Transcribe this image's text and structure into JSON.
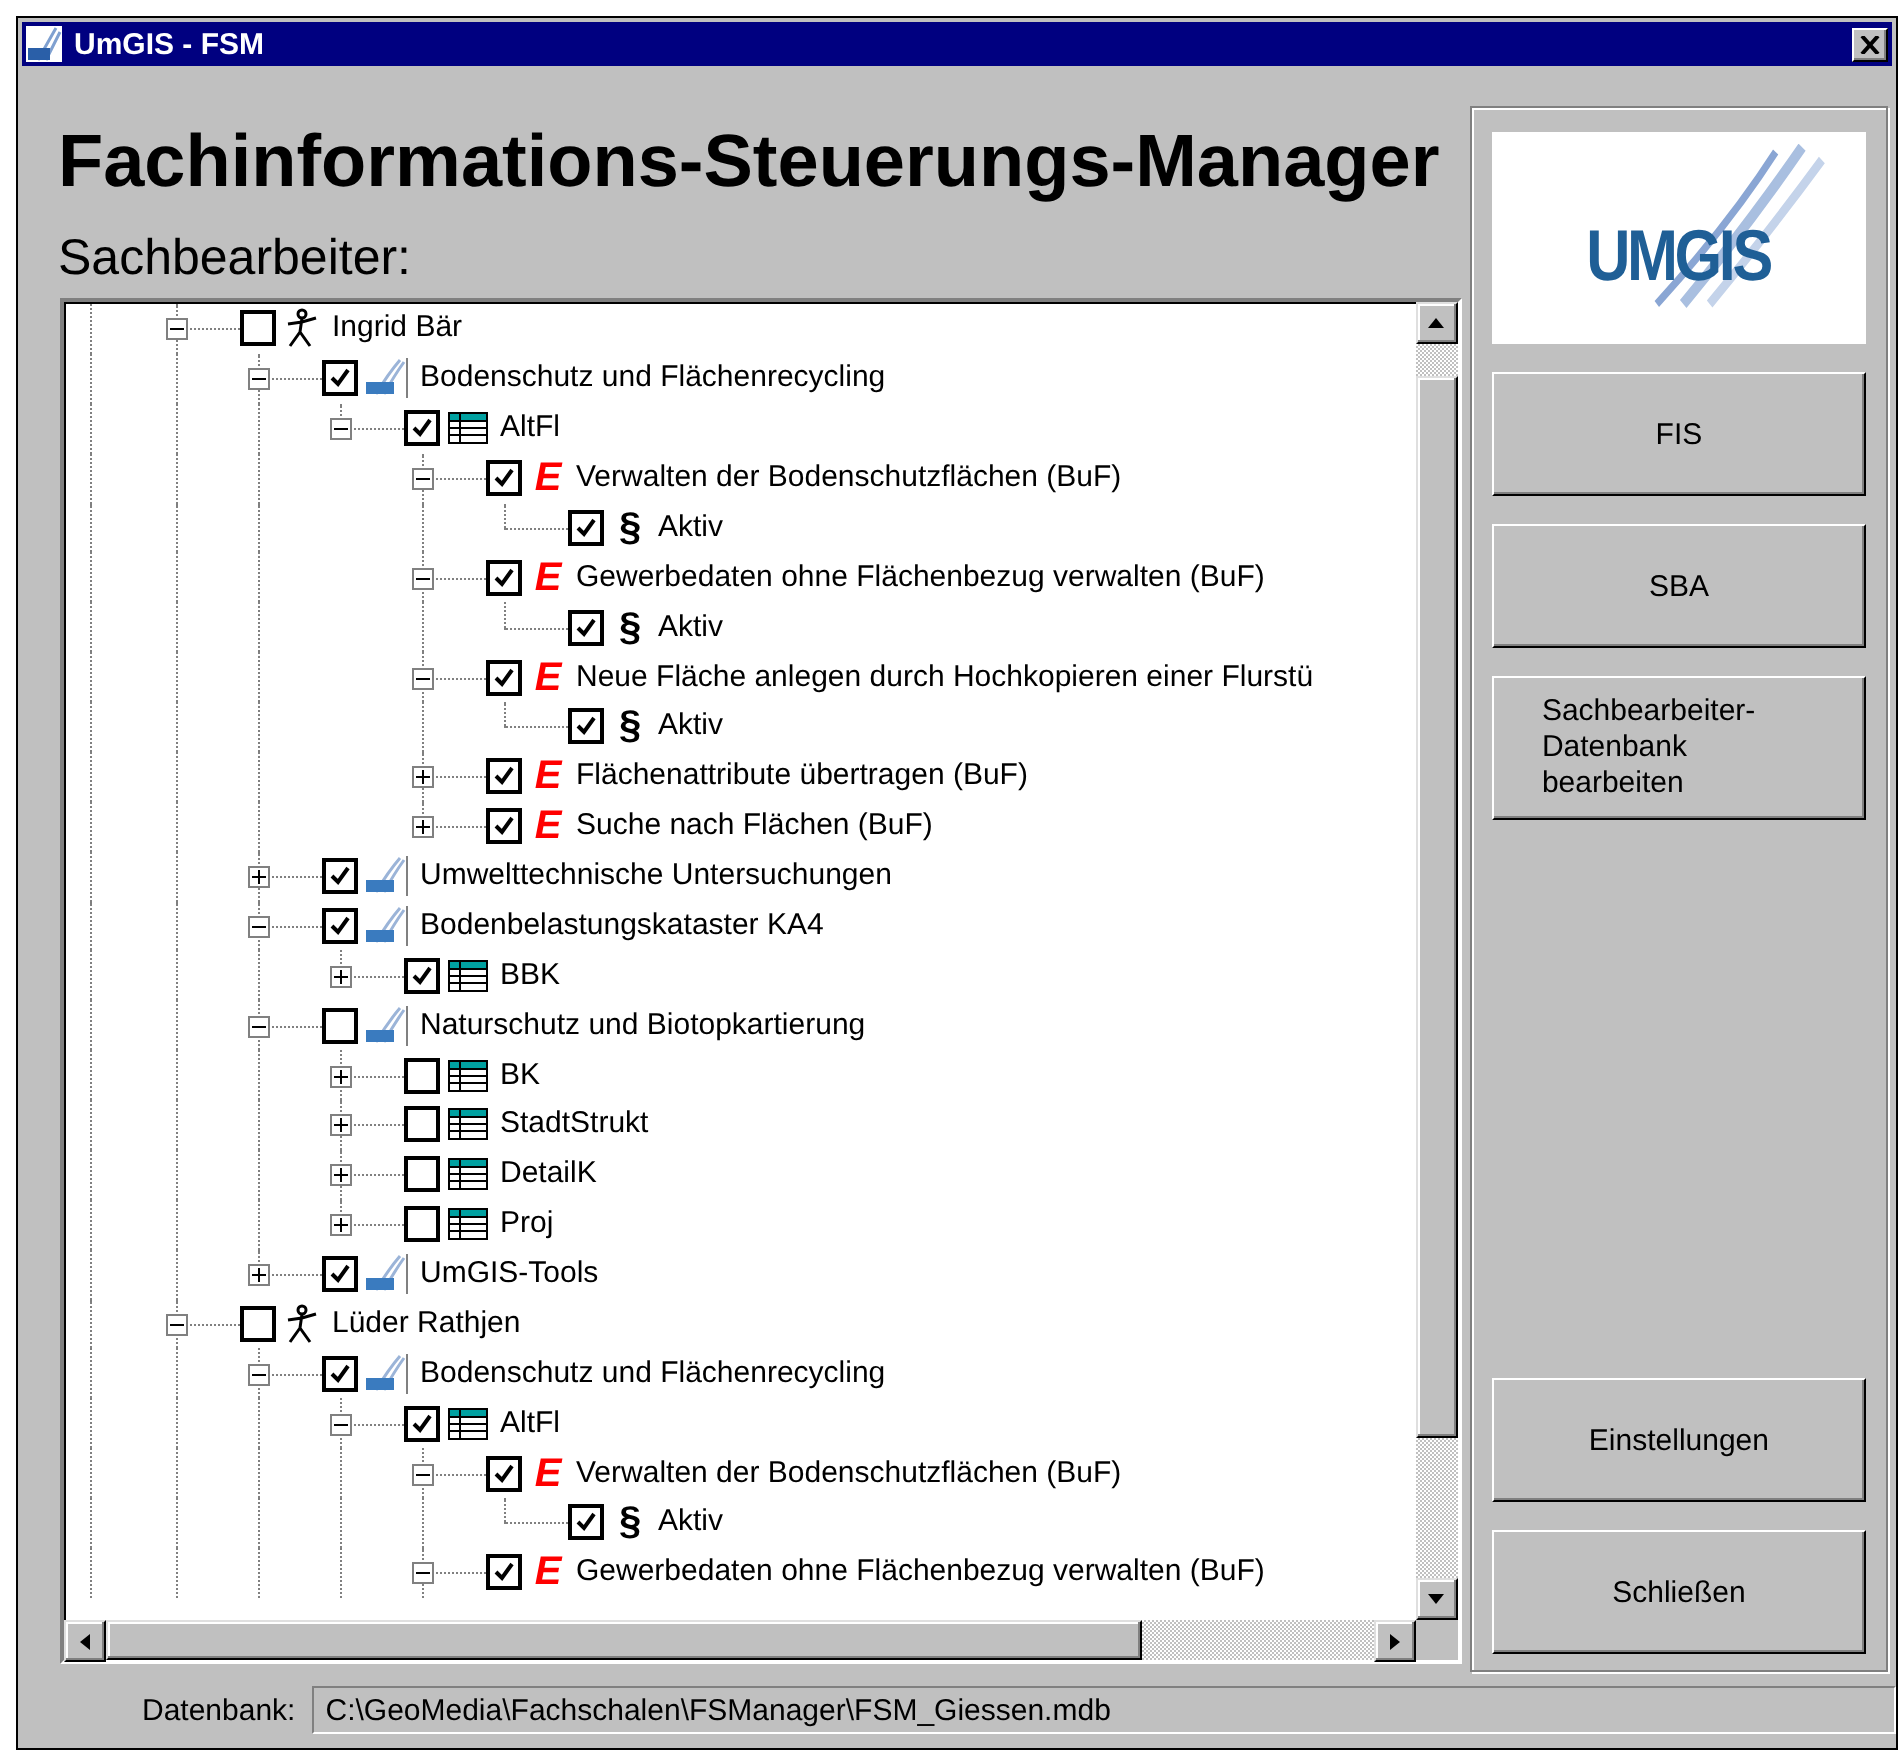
{
  "window": {
    "title": "UmGIS - FSM"
  },
  "heading": "Fachinformations-Steuerungs-Manager",
  "tree_label": "Sachbearbeiter:",
  "tree": [
    {
      "kind": "person",
      "label": "Ingrid Bär",
      "checked": false,
      "expanded": true,
      "children": [
        {
          "kind": "module",
          "label": "Bodenschutz und Flächenrecycling",
          "checked": true,
          "expanded": true,
          "children": [
            {
              "kind": "table",
              "label": "AltFl",
              "checked": true,
              "expanded": true,
              "children": [
                {
                  "kind": "function",
                  "glyph": "E",
                  "label": "Verwalten der Bodenschutzflächen (BuF)",
                  "checked": true,
                  "expanded": true,
                  "children": [
                    {
                      "kind": "status",
                      "glyph": "§",
                      "label": "Aktiv",
                      "checked": true
                    }
                  ]
                },
                {
                  "kind": "function",
                  "glyph": "E",
                  "label": "Gewerbedaten ohne Flächenbezug verwalten (BuF)",
                  "checked": true,
                  "expanded": true,
                  "children": [
                    {
                      "kind": "status",
                      "glyph": "§",
                      "label": "Aktiv",
                      "checked": true
                    }
                  ]
                },
                {
                  "kind": "function",
                  "glyph": "E",
                  "label": "Neue Fläche anlegen durch Hochkopieren einer Flurstü",
                  "checked": true,
                  "expanded": true,
                  "children": [
                    {
                      "kind": "status",
                      "glyph": "§",
                      "label": "Aktiv",
                      "checked": true
                    }
                  ]
                },
                {
                  "kind": "function",
                  "glyph": "E",
                  "label": "Flächenattribute übertragen (BuF)",
                  "checked": true,
                  "expanded": false
                },
                {
                  "kind": "function",
                  "glyph": "E",
                  "label": "Suche nach Flächen (BuF)",
                  "checked": true,
                  "expanded": false
                }
              ]
            }
          ]
        },
        {
          "kind": "module",
          "label": "Umwelttechnische Untersuchungen",
          "checked": true,
          "expanded": false
        },
        {
          "kind": "module",
          "label": "Bodenbelastungskataster KA4",
          "checked": true,
          "expanded": true,
          "children": [
            {
              "kind": "table",
              "label": "BBK",
              "checked": true,
              "expanded": false
            }
          ]
        },
        {
          "kind": "module",
          "label": "Naturschutz und Biotopkartierung",
          "checked": false,
          "expanded": true,
          "children": [
            {
              "kind": "table",
              "label": "BK",
              "checked": false,
              "expanded": false
            },
            {
              "kind": "table",
              "label": "StadtStrukt",
              "checked": false,
              "expanded": false
            },
            {
              "kind": "table",
              "label": "DetailK",
              "checked": false,
              "expanded": false
            },
            {
              "kind": "table",
              "label": "Proj",
              "checked": false,
              "expanded": false
            }
          ]
        },
        {
          "kind": "module",
          "label": "UmGIS-Tools",
          "checked": true,
          "expanded": false
        }
      ]
    },
    {
      "kind": "person",
      "label": "Lüder Rathjen",
      "checked": false,
      "expanded": true,
      "children": [
        {
          "kind": "module",
          "label": "Bodenschutz und Flächenrecycling",
          "checked": true,
          "expanded": true,
          "children": [
            {
              "kind": "table",
              "label": "AltFl",
              "checked": true,
              "expanded": true,
              "children": [
                {
                  "kind": "function",
                  "glyph": "E",
                  "label": "Verwalten der Bodenschutzflächen (BuF)",
                  "checked": true,
                  "expanded": true,
                  "children": [
                    {
                      "kind": "status",
                      "glyph": "§",
                      "label": "Aktiv",
                      "checked": true
                    }
                  ]
                },
                {
                  "kind": "function",
                  "glyph": "E",
                  "label": "Gewerbedaten ohne Flächenbezug verwalten (BuF)",
                  "checked": true,
                  "expanded": true
                }
              ]
            }
          ]
        }
      ]
    }
  ],
  "logo": {
    "text": "UMGIS"
  },
  "buttons_top": [
    {
      "kind": "plain",
      "label": "FIS"
    },
    {
      "kind": "plain",
      "label": "SBA"
    },
    {
      "kind": "wrapped",
      "label": "Sachbearbeiter-Datenbank bearbeiten"
    }
  ],
  "buttons_bottom": [
    {
      "label": "Einstellungen"
    },
    {
      "label": "Schließen"
    }
  ],
  "status": {
    "label": "Datenbank:",
    "value": "C:\\GeoMedia\\Fachschalen\\FSManager\\FSM_Giessen.mdb"
  }
}
